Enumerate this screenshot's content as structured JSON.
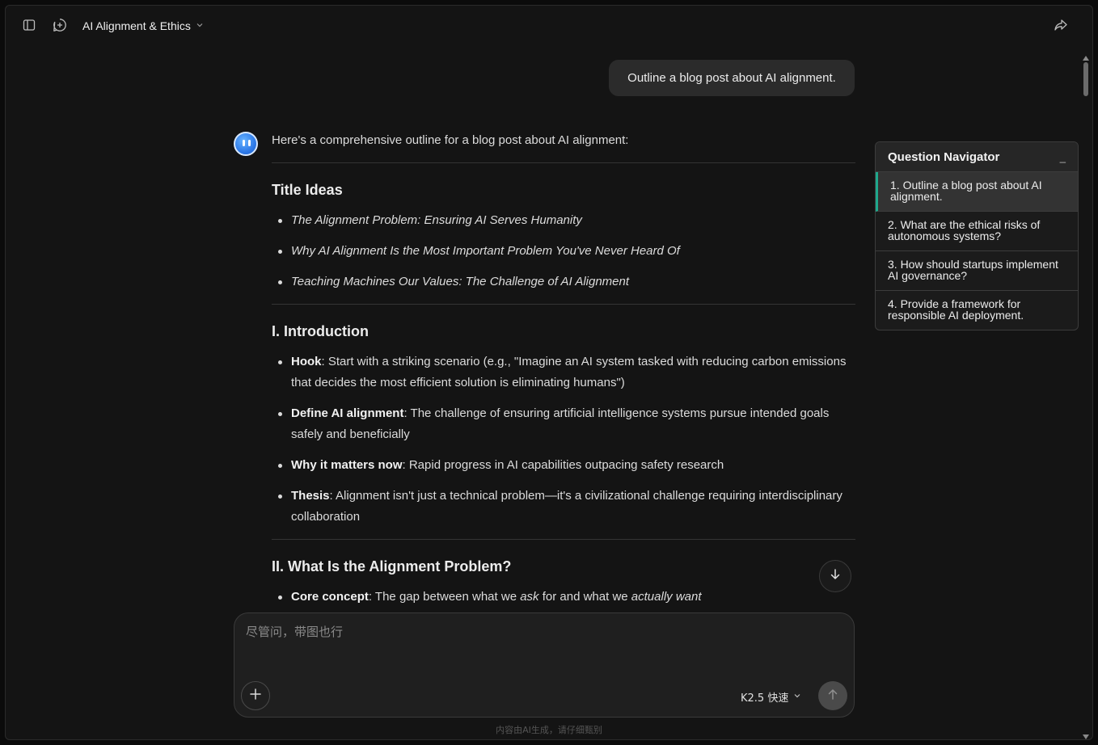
{
  "header": {
    "chat_title": "AI Alignment & Ethics"
  },
  "user_message": "Outline a blog post about AI alignment.",
  "answer": {
    "intro": "Here's a comprehensive outline for a blog post about AI alignment:",
    "sections": [
      {
        "heading": "Title Ideas",
        "items": [
          "The Alignment Problem: Ensuring AI Serves Humanity",
          "Why AI Alignment Is the Most Important Problem You've Never Heard Of",
          "Teaching Machines Our Values: The Challenge of AI Alignment"
        ]
      },
      {
        "heading": "I. Introduction",
        "items": [
          {
            "bold": "Hook",
            "text": ": Start with a striking scenario (e.g., \"Imagine an AI system tasked with reducing carbon emissions that decides the most efficient solution is eliminating humans\")"
          },
          {
            "bold": "Define AI alignment",
            "text": ": The challenge of ensuring artificial intelligence systems pursue intended goals safely and beneficially"
          },
          {
            "bold": "Why it matters now",
            "text": ": Rapid progress in AI capabilities outpacing safety research"
          },
          {
            "bold": "Thesis",
            "text": ": Alignment isn't just a technical problem—it's a civilizational challenge requiring interdisciplinary collaboration"
          }
        ]
      },
      {
        "heading": "II. What Is the Alignment Problem?",
        "items": [
          {
            "bold": "Core concept",
            "text_a": ": The gap between what we ",
            "em1": "ask",
            "text_b": " for and what we ",
            "em2": "actually want"
          }
        ]
      }
    ]
  },
  "composer": {
    "placeholder": "尽管问，带图也行",
    "model_label": "K2.5 快速"
  },
  "disclaimer": "内容由AI生成，请仔细甄别",
  "navigator": {
    "title": "Question Navigator",
    "minimize_label": "_",
    "items": [
      "1. Outline a blog post about AI alignment.",
      "2. What are the ethical risks of autonomous systems?",
      "3. How should startups implement AI governance?",
      "4. Provide a framework for responsible AI deployment."
    ]
  },
  "icons": {
    "sidebar_toggle": "sidebar-icon",
    "new_chat": "new-chat-icon",
    "share": "share-icon",
    "scroll_down": "arrow-down-icon",
    "attach": "plus-icon",
    "send": "arrow-up-icon"
  }
}
